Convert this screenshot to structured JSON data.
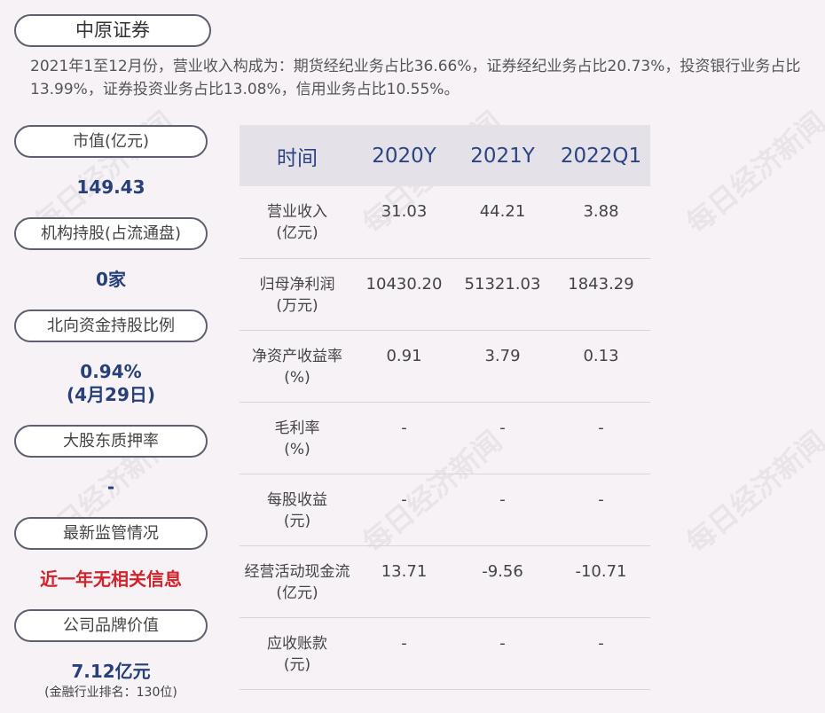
{
  "company_name": "中原证券",
  "summary": "2021年1至12月份，营业收入构成为：期货经纪业务占比36.66%，证券经纪业务占比20.73%，投资银行业务占比13.99%，证券投资业务占比13.08%，信用业务占比10.55%。",
  "sidebar": {
    "market_cap": {
      "label": "市值(亿元)",
      "value": "149.43"
    },
    "institution_holding": {
      "label": "机构持股(占流通盘)",
      "value": "0家"
    },
    "northbound": {
      "label": "北向资金持股比例",
      "value": "0.94%",
      "date": "(4月29日)"
    },
    "pledge": {
      "label": "大股东质押率",
      "value": "-"
    },
    "regulation": {
      "label": "最新监管情况",
      "value": "近一年无相关信息"
    },
    "brand": {
      "label": "公司品牌价值",
      "value": "7.12亿元",
      "rank": "(金融行业排名：130位)"
    }
  },
  "table": {
    "headers": [
      "时间",
      "2020Y",
      "2021Y",
      "2022Q1"
    ],
    "rows": [
      {
        "label": "营业收入",
        "unit": "(亿元)",
        "values": [
          "31.03",
          "44.21",
          "3.88"
        ]
      },
      {
        "label": "归母净利润",
        "unit": "(万元)",
        "values": [
          "10430.20",
          "51321.03",
          "1843.29"
        ]
      },
      {
        "label": "净资产收益率",
        "unit": "(%)",
        "values": [
          "0.91",
          "3.79",
          "0.13"
        ]
      },
      {
        "label": "毛利率",
        "unit": "(%)",
        "values": [
          "-",
          "-",
          "-"
        ]
      },
      {
        "label": "每股收益",
        "unit": "(元)",
        "values": [
          "-",
          "-",
          "-"
        ]
      },
      {
        "label": "经营活动现金流",
        "unit": "(亿元)",
        "values": [
          "13.71",
          "-9.56",
          "-10.71"
        ]
      },
      {
        "label": "应收账款",
        "unit": "(元)",
        "values": [
          "-",
          "-",
          "-"
        ]
      }
    ]
  },
  "watermark": "每日经济新闻"
}
